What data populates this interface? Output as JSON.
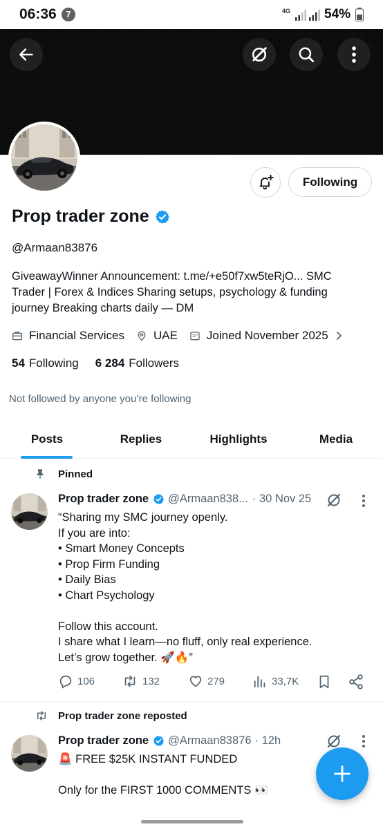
{
  "status_bar": {
    "time": "06:36",
    "notification_count": "7",
    "network_type": "4G",
    "battery_percent": "54%"
  },
  "profile": {
    "name": "Prop trader zone",
    "handle": "@Armaan83876",
    "bio": "GiveawayWinner Announcement: t.me/+e50f7xw5teRjO... SMC Trader | Forex & Indices Sharing setups, psychology & funding journey Breaking charts daily — DM",
    "category": "Financial Services",
    "location": "UAE",
    "joined": "Joined November 2025",
    "following_count": "54",
    "following_label": "Following",
    "followers_count": "6 284",
    "followers_label": "Followers",
    "follow_button": "Following",
    "not_followed_text": "Not followed by anyone you’re following"
  },
  "tabs": [
    {
      "label": "Posts",
      "active": true
    },
    {
      "label": "Replies",
      "active": false
    },
    {
      "label": "Highlights",
      "active": false
    },
    {
      "label": "Media",
      "active": false
    }
  ],
  "posts": [
    {
      "context_label": "Pinned",
      "author": "Prop trader zone",
      "handle": "@Armaan838...",
      "time": "· 30 Nov 25",
      "lines": [
        "“Sharing my SMC journey openly.",
        "If you are into:",
        "• Smart Money Concepts",
        "• Prop Firm Funding",
        "• Daily Bias",
        "• Chart Psychology",
        "",
        "Follow this account.",
        "I share what I learn—no fluff, only real experience.",
        "Let’s grow together. 🚀🔥”"
      ],
      "replies": "106",
      "reposts": "132",
      "likes": "279",
      "views": "33,7K"
    },
    {
      "context_label": "Prop trader zone reposted",
      "author": "Prop trader zone",
      "handle": "@Armaan83876",
      "time": "· 12h",
      "lines": [
        "🚨 FREE $25K INSTANT FUNDED",
        "",
        "Only for the FIRST 1000 COMMENTS 👀"
      ]
    }
  ],
  "colors": {
    "accent": "#1d9bf0",
    "text": "#0f1419",
    "muted": "#536471",
    "banner": "#0b0b0b"
  }
}
